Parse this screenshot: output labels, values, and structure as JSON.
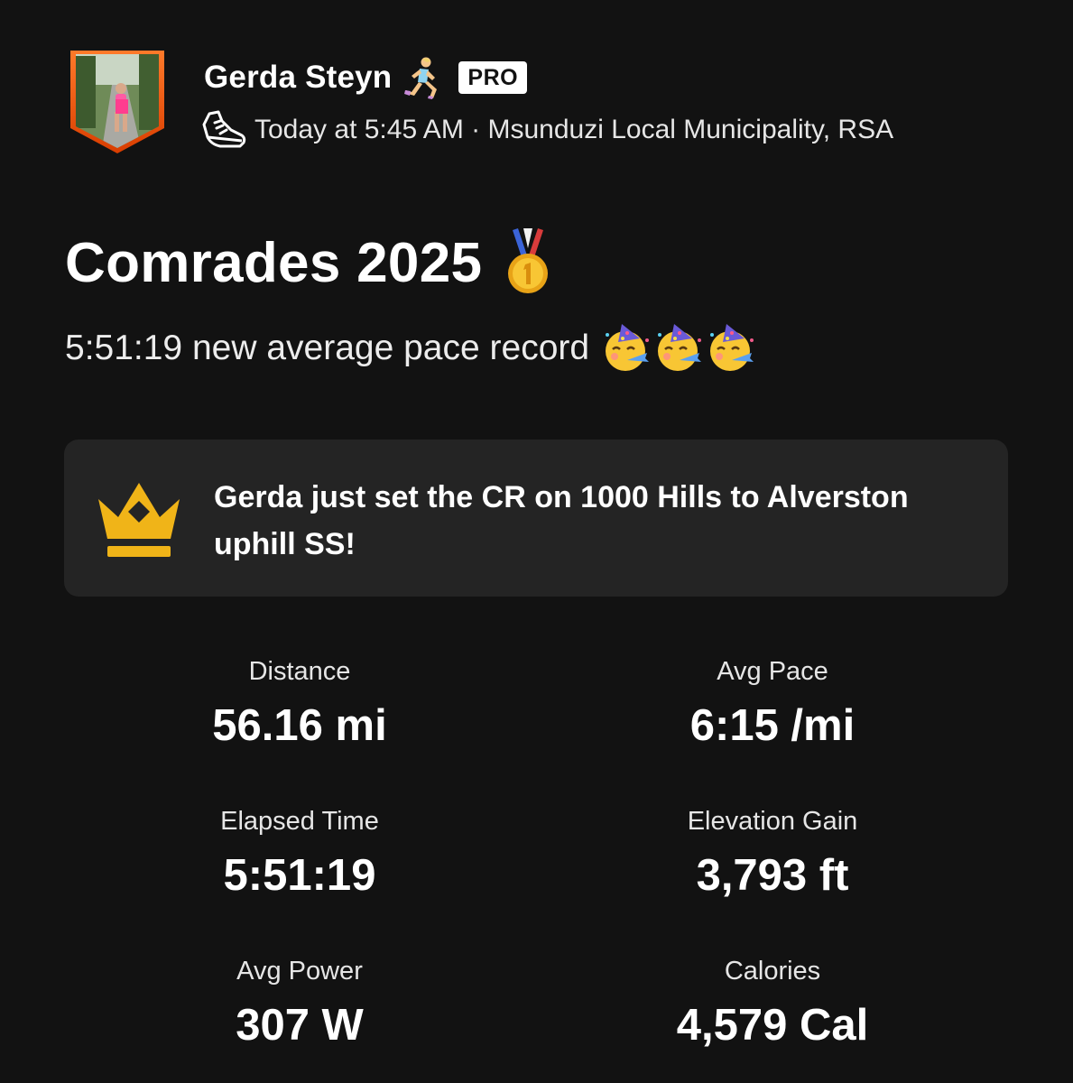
{
  "header": {
    "athlete_name": "Gerda Steyn",
    "badge": "PRO",
    "meta": "Today at 5:45 AM · Msunduzi Local Municipality, RSA",
    "icons": [
      "runner-icon",
      "shoe-icon"
    ]
  },
  "activity": {
    "title": "Comrades 2025",
    "description": "5:51:19 new average pace record"
  },
  "achievement": {
    "text": "Gerda just set the CR on 1000 Hills to Alverston uphill SS!",
    "icon": "crown-icon"
  },
  "stats": [
    {
      "label": "Distance",
      "value": "56.16 mi"
    },
    {
      "label": "Avg Pace",
      "value": "6:15 /mi"
    },
    {
      "label": "Elapsed Time",
      "value": "5:51:19"
    },
    {
      "label": "Elevation Gain",
      "value": "3,793 ft"
    },
    {
      "label": "Avg Power",
      "value": "307 W"
    },
    {
      "label": "Calories",
      "value": "4,579 Cal"
    }
  ],
  "colors": {
    "background": "#121212",
    "card": "#242424",
    "crown": "#f0b418",
    "avatar_border": "#fc5200"
  }
}
